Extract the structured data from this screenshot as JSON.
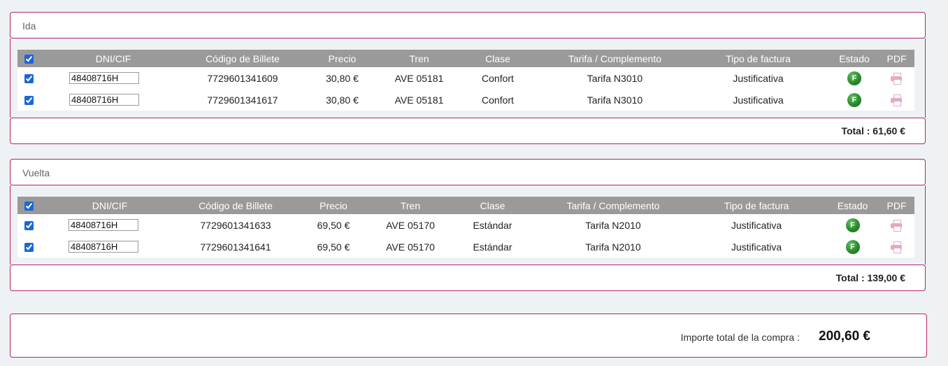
{
  "sections": [
    {
      "title": "Ida",
      "headers": [
        "DNI/CIF",
        "Código de Billete",
        "Precio",
        "Tren",
        "Clase",
        "Tarifa / Complemento",
        "Tipo de factura",
        "Estado",
        "PDF"
      ],
      "rows": [
        {
          "dni": "48408716H",
          "codigo": "7729601341609",
          "precio": "30,80 €",
          "tren": "AVE 05181",
          "clase": "Confort",
          "tarifa": "Tarifa N3010",
          "tipo": "Justificativa",
          "estado": "F"
        },
        {
          "dni": "48408716H",
          "codigo": "7729601341617",
          "precio": "30,80 €",
          "tren": "AVE 05181",
          "clase": "Confort",
          "tarifa": "Tarifa N3010",
          "tipo": "Justificativa",
          "estado": "F"
        }
      ],
      "total_label": "Total : 61,60 €"
    },
    {
      "title": "Vuelta",
      "headers": [
        "DNI/CIF",
        "Código de Billete",
        "Precio",
        "Tren",
        "Clase",
        "Tarifa / Complemento",
        "Tipo de factura",
        "Estado",
        "PDF"
      ],
      "rows": [
        {
          "dni": "48408716H",
          "codigo": "7729601341633",
          "precio": "69,50 €",
          "tren": "AVE 05170",
          "clase": "Estándar",
          "tarifa": "Tarifa N2010",
          "tipo": "Justificativa",
          "estado": "F"
        },
        {
          "dni": "48408716H",
          "codigo": "7729601341641",
          "precio": "69,50 €",
          "tren": "AVE 05170",
          "clase": "Estándar",
          "tarifa": "Tarifa N2010",
          "tipo": "Justificativa",
          "estado": "F"
        }
      ],
      "total_label": "Total : 139,00 €"
    }
  ],
  "purchase": {
    "label": "Importe total de la compra :",
    "value": "200,60 €"
  },
  "colors": {
    "border": "#b3236b",
    "header_bg": "#9a9a9a",
    "estado_green": "#2a8a2c",
    "pdf_icon": "#e3a9c7"
  },
  "icons": {
    "estado": "status-f-icon",
    "pdf": "printer-icon"
  }
}
